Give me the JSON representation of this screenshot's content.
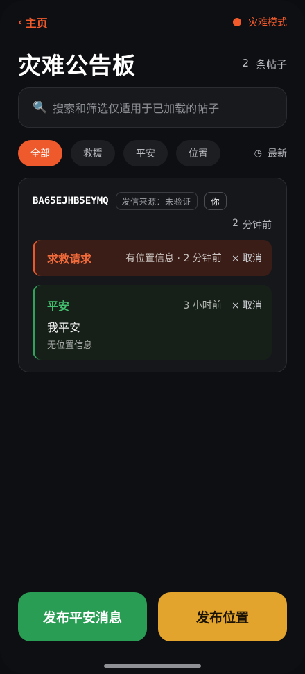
{
  "topbar": {
    "back_chevron": "‹",
    "back_label": "主页",
    "mode_label": "灾难模式",
    "mode_color": "#f15a2b"
  },
  "header": {
    "title": "灾难公告板",
    "count_value": "2",
    "count_unit": "条帖子"
  },
  "search": {
    "icon": "search-icon",
    "placeholder": "搜索和筛选仅适用于已加载的帖子"
  },
  "filters": {
    "chips": [
      {
        "label": "全部",
        "active": true
      },
      {
        "label": "救援",
        "active": false
      },
      {
        "label": "平安",
        "active": false
      },
      {
        "label": "位置",
        "active": false
      }
    ],
    "sort_icon": "◷",
    "sort_label": "最新"
  },
  "card": {
    "user_id": "BA65EJHB5EYMQ",
    "source_badge": "发信来源：未验证",
    "you_badge": "你",
    "time_value": "2",
    "time_unit": "分钟前",
    "sos": {
      "label": "求救请求",
      "meta": "有位置信息 · 2 分钟前",
      "cancel": "× 取消",
      "accent": "#e8582a"
    },
    "safe": {
      "label": "平安",
      "meta": "3 小时前",
      "cancel": "× 取消",
      "message": "我平安",
      "location": "无位置信息",
      "accent": "#2fa35a"
    }
  },
  "actions": {
    "post_safe": "发布平安消息",
    "post_location": "发布位置"
  }
}
